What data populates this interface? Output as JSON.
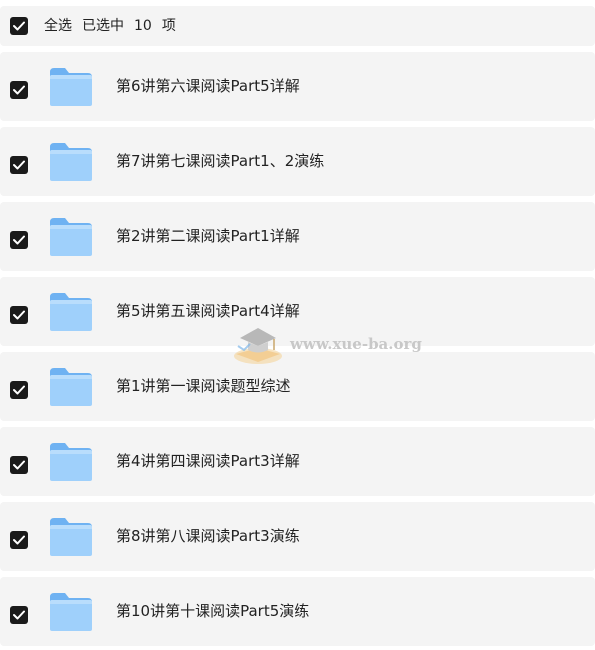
{
  "header": {
    "select_all_label": "全选",
    "selected_prefix": "已选中",
    "selected_count": "10",
    "selected_suffix": "项",
    "checked": true
  },
  "items": [
    {
      "name": "第6讲第六课阅读Part5详解",
      "checked": true,
      "icon": "folder-icon"
    },
    {
      "name": "第7讲第七课阅读Part1、2演练",
      "checked": true,
      "icon": "folder-icon"
    },
    {
      "name": "第2讲第二课阅读Part1详解",
      "checked": true,
      "icon": "folder-icon"
    },
    {
      "name": "第5讲第五课阅读Part4详解",
      "checked": true,
      "icon": "folder-icon"
    },
    {
      "name": "第1讲第一课阅读题型综述",
      "checked": true,
      "icon": "folder-icon"
    },
    {
      "name": "第4讲第四课阅读Part3详解",
      "checked": true,
      "icon": "folder-icon"
    },
    {
      "name": "第8讲第八课阅读Part3演练",
      "checked": true,
      "icon": "folder-icon"
    },
    {
      "name": "第10讲第十课阅读Part5演练",
      "checked": true,
      "icon": "folder-icon"
    }
  ],
  "watermark": {
    "text": "www.xue-ba.org",
    "icon": "graduation-cap-icon"
  },
  "colors": {
    "row_background": "#f4f4f4",
    "checkbox": "#1a1a1a",
    "folder_light": "#9fd0fb",
    "folder_dark": "#6fb2f2"
  }
}
